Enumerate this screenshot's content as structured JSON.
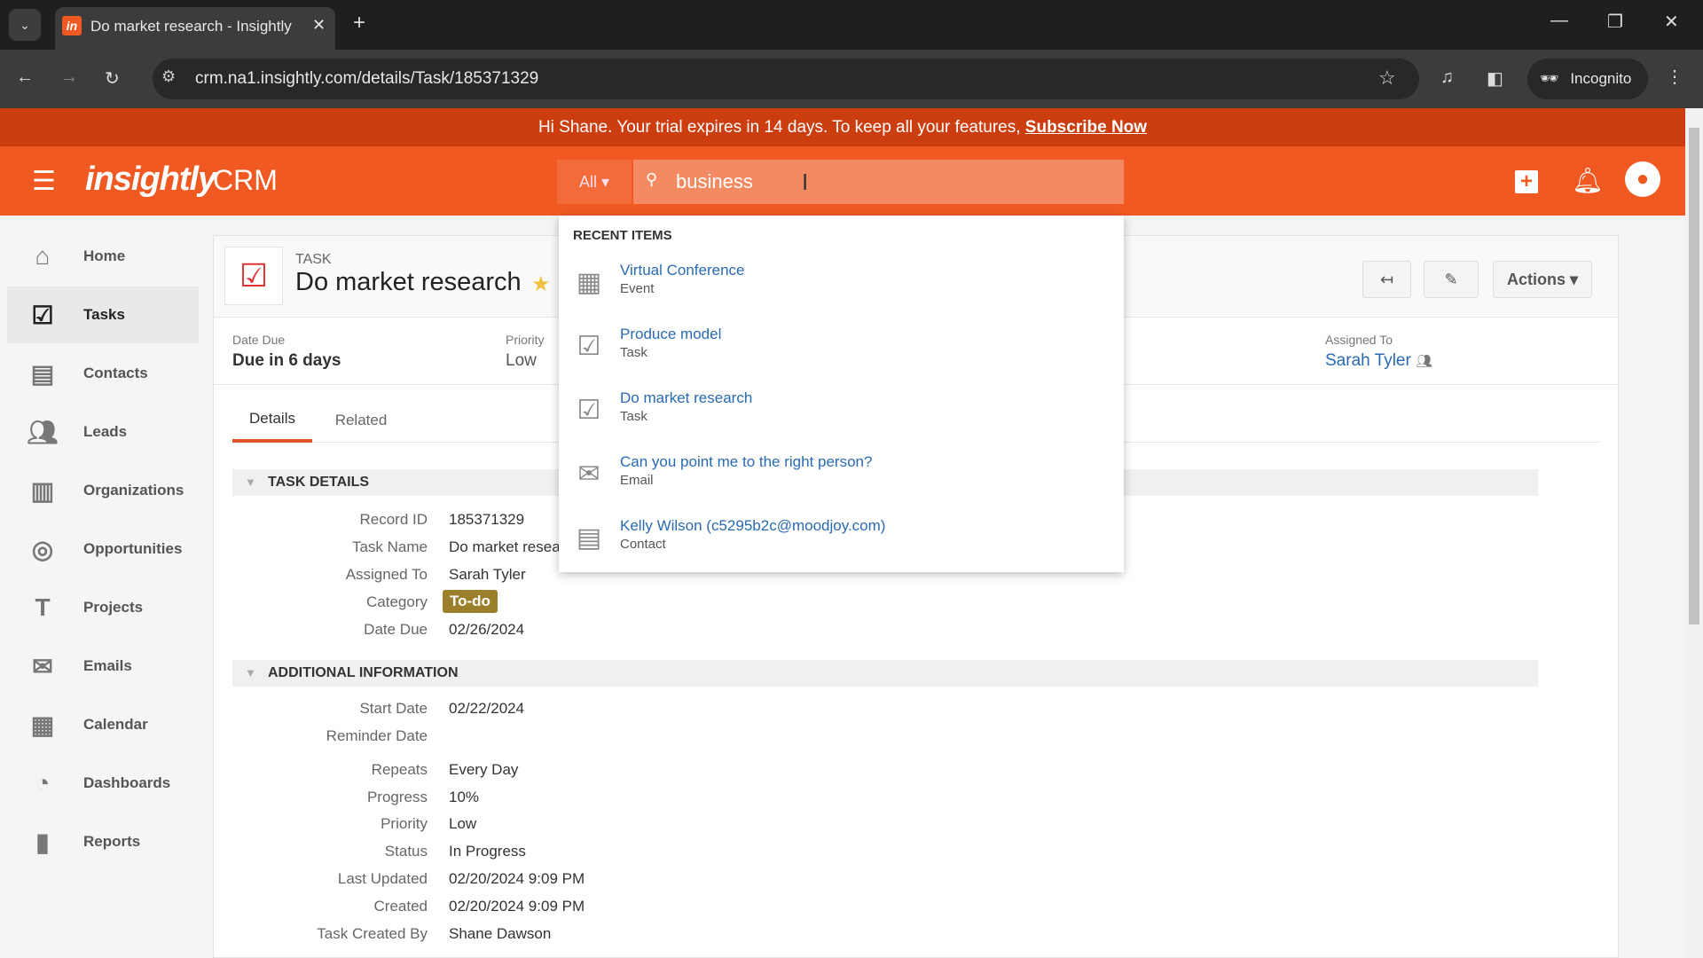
{
  "browser": {
    "tab_title": "Do market research - Insightly",
    "url": "crm.na1.insightly.com/details/Task/185371329",
    "incognito_label": "Incognito"
  },
  "banner": {
    "text": "Hi Shane. Your trial expires in 14 days. To keep all your features,",
    "link": "Subscribe Now"
  },
  "header": {
    "logo": "insightly",
    "product": "CRM",
    "search_scope": "All",
    "search_value": "business"
  },
  "sidebar": {
    "items": [
      {
        "label": "Home",
        "icon": "home-icon"
      },
      {
        "label": "Tasks",
        "icon": "tasks-icon",
        "active": true
      },
      {
        "label": "Contacts",
        "icon": "contacts-icon"
      },
      {
        "label": "Leads",
        "icon": "leads-icon"
      },
      {
        "label": "Organizations",
        "icon": "organizations-icon"
      },
      {
        "label": "Opportunities",
        "icon": "opportunities-icon"
      },
      {
        "label": "Projects",
        "icon": "projects-icon"
      },
      {
        "label": "Emails",
        "icon": "emails-icon"
      },
      {
        "label": "Calendar",
        "icon": "calendar-icon"
      },
      {
        "label": "Dashboards",
        "icon": "dashboards-icon"
      },
      {
        "label": "Reports",
        "icon": "reports-icon"
      }
    ]
  },
  "record": {
    "type": "TASK",
    "title": "Do market research",
    "actions_label": "Actions",
    "summary": {
      "date_due_label": "Date Due",
      "date_due": "Due in 6 days",
      "priority_label": "Priority",
      "priority": "Low",
      "assigned_label": "Assigned To",
      "assigned": "Sarah Tyler"
    },
    "tabs": [
      "Details",
      "Related"
    ],
    "task_details": {
      "title": "TASK DETAILS",
      "rows": [
        {
          "label": "Record ID",
          "value": "185371329"
        },
        {
          "label": "Task Name",
          "value": "Do market resea"
        },
        {
          "label": "Assigned To",
          "value": "Sarah Tyler"
        },
        {
          "label": "Category",
          "value": "To-do"
        },
        {
          "label": "Date Due",
          "value": "02/26/2024"
        }
      ]
    },
    "additional": {
      "title": "ADDITIONAL INFORMATION",
      "rows": [
        {
          "label": "Start Date",
          "value": "02/22/2024"
        },
        {
          "label": "Reminder Date",
          "value": ""
        },
        {
          "label": "Repeats",
          "value": "Every Day"
        },
        {
          "label": "Progress",
          "value": "10%"
        },
        {
          "label": "Priority",
          "value": "Low"
        },
        {
          "label": "Status",
          "value": "In Progress"
        },
        {
          "label": "Last Updated",
          "value": "02/20/2024 9:09 PM"
        },
        {
          "label": "Created",
          "value": "02/20/2024 9:09 PM"
        },
        {
          "label": "Task Created By",
          "value": "Shane Dawson"
        }
      ]
    }
  },
  "dropdown": {
    "heading": "RECENT ITEMS",
    "items": [
      {
        "title": "Virtual Conference",
        "type": "Event",
        "icon": "calendar-icon"
      },
      {
        "title": "Produce model",
        "type": "Task",
        "icon": "task-check-icon"
      },
      {
        "title": "Do market research",
        "type": "Task",
        "icon": "task-check-icon"
      },
      {
        "title": "Can you point me to the right person?",
        "type": "Email",
        "icon": "envelope-icon"
      },
      {
        "title": "Kelly Wilson (c5295b2c@moodjoy.com)",
        "type": "Contact",
        "icon": "contact-card-icon"
      }
    ]
  },
  "colors": {
    "brand": "#f05a22",
    "banner": "#cc3d0f",
    "link": "#2a6ab0",
    "category_badge": "#9c7f2a"
  }
}
